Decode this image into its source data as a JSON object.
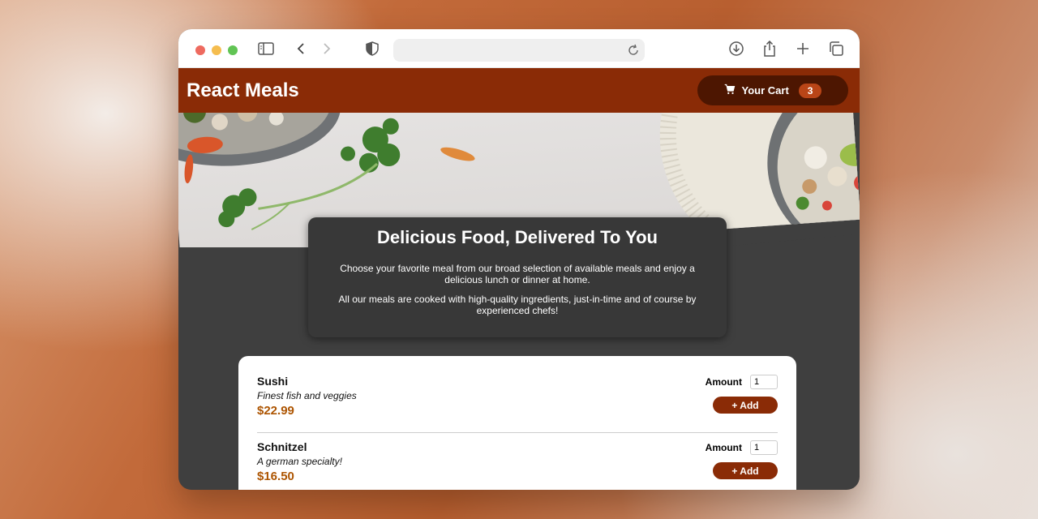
{
  "browser": {
    "url": "",
    "icons": [
      "sidebar-icon",
      "back-icon",
      "forward-icon",
      "shield-icon",
      "reload-icon",
      "download-icon",
      "share-icon",
      "new-tab-icon",
      "tabs-overview-icon"
    ]
  },
  "header": {
    "title": "React Meals",
    "cart_label": "Your Cart",
    "cart_count": "3",
    "cart_icon": "cart-icon"
  },
  "summary": {
    "heading": "Delicious Food, Delivered To You",
    "paragraph1": "Choose your favorite meal from our broad selection of available meals and enjoy a delicious lunch or dinner at home.",
    "paragraph2": "All our meals are cooked with high-quality ingredients, just-in-time and of course by experienced chefs!"
  },
  "meals": [
    {
      "name": "Sushi",
      "description": "Finest fish and veggies",
      "price": "$22.99",
      "amount_label": "Amount",
      "amount": "1",
      "add_label": "+ Add"
    },
    {
      "name": "Schnitzel",
      "description": "A german specialty!",
      "price": "$16.50",
      "amount_label": "Amount",
      "amount": "1",
      "add_label": "+ Add"
    }
  ],
  "colors": {
    "header": "#8a2b06",
    "cart_button": "#4d1601",
    "badge": "#b94517",
    "price": "#ad5502",
    "background": "#3f3f3f"
  }
}
